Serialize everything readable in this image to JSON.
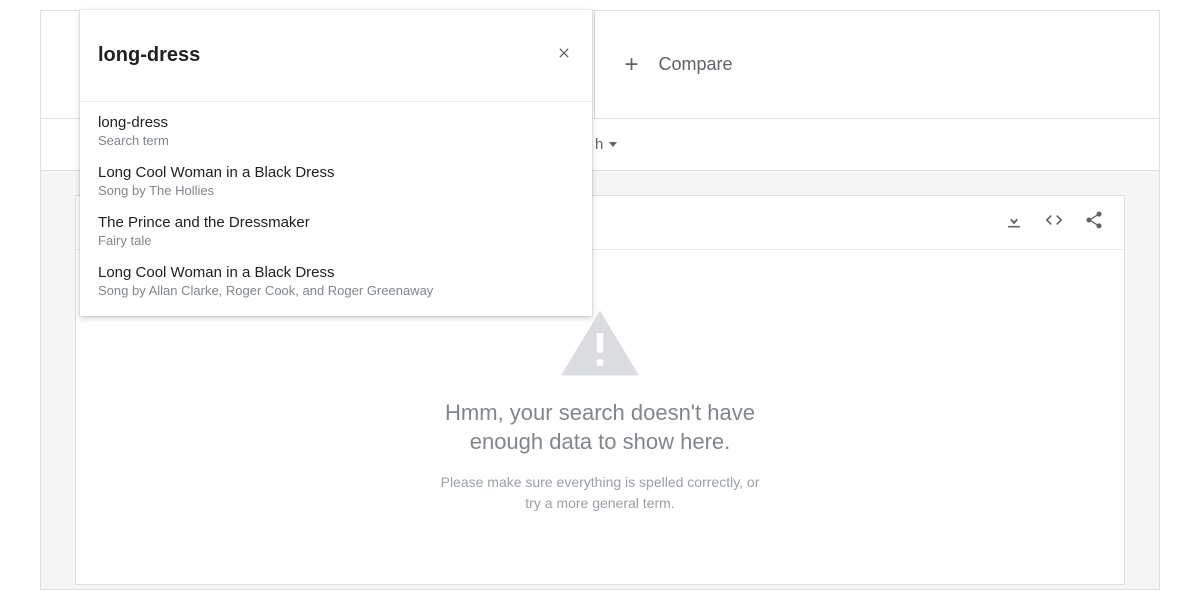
{
  "search": {
    "value": "long-dress",
    "placeholder": ""
  },
  "compare": {
    "label": "Compare"
  },
  "filter_visible_fragment": "h",
  "suggestions": [
    {
      "title": "long-dress",
      "subtitle": "Search term"
    },
    {
      "title": "Long Cool Woman in a Black Dress",
      "subtitle": "Song by The Hollies"
    },
    {
      "title": "The Prince and the Dressmaker",
      "subtitle": "Fairy tale"
    },
    {
      "title": "Long Cool Woman in a Black Dress",
      "subtitle": "Song by Allan Clarke, Roger Cook, and Roger Greenaway"
    }
  ],
  "empty_state": {
    "title_line1": "Hmm, your search doesn't have",
    "title_line2": "enough data to show here.",
    "sub_line1": "Please make sure everything is spelled correctly, or",
    "sub_line2": "try a more general term."
  }
}
